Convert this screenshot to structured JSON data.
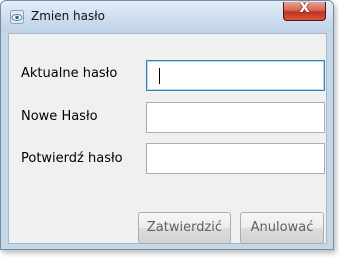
{
  "window": {
    "title": "Zmien hasło",
    "icon": "eye-icon",
    "close_glyph": "X"
  },
  "form": {
    "current_password_label": "Aktualne hasło",
    "new_password_label": "Nowe Hasło",
    "confirm_password_label": "Potwierdź hasło",
    "current_password_value": "",
    "new_password_value": "",
    "confirm_password_value": ""
  },
  "buttons": {
    "confirm_label": "Zatwierdzić",
    "cancel_label": "Anulować"
  },
  "colors": {
    "close_button": "#c0321e",
    "focus_border": "#3c7fb1"
  }
}
